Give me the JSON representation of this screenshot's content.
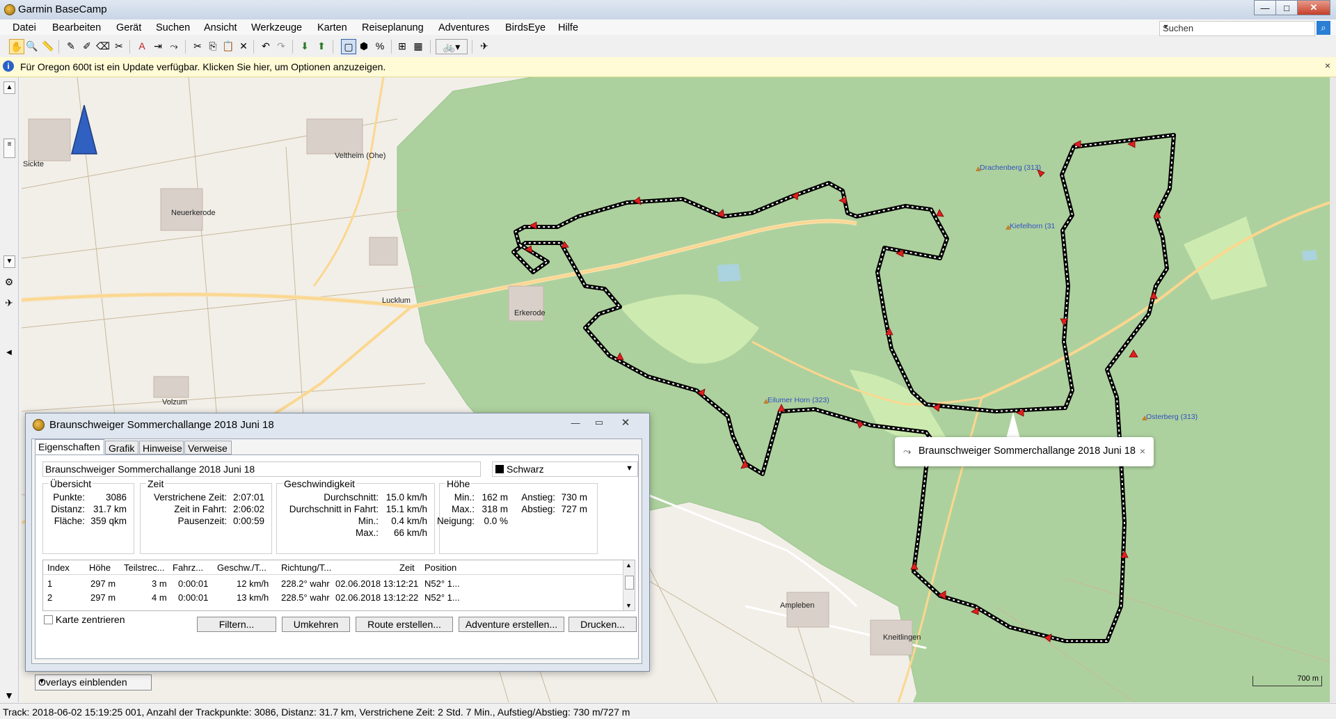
{
  "window": {
    "title": "Garmin BaseCamp",
    "min": "—",
    "max": "□",
    "close": "✕"
  },
  "menu": [
    "Datei",
    "Bearbeiten",
    "Gerät",
    "Suchen",
    "Ansicht",
    "Werkzeuge",
    "Karten",
    "Reiseplanung",
    "Adventures",
    "BirdsEye",
    "Hilfe"
  ],
  "search": {
    "placeholder": "Suchen"
  },
  "infobar": {
    "text": "Für Oregon 600t  ist ein Update verfügbar. Klicken Sie hier, um Optionen anzuzeigen."
  },
  "map": {
    "places": [
      {
        "name": "Sickte"
      },
      {
        "name": "Veltheim (Ohe)"
      },
      {
        "name": "Neuerkerode"
      },
      {
        "name": "Lucklum"
      },
      {
        "name": "Erkerode"
      },
      {
        "name": "Volzum"
      },
      {
        "name": "Ampleben"
      },
      {
        "name": "Kneitlingen"
      }
    ],
    "peaks": [
      {
        "name": "Drachenberg (313)"
      },
      {
        "name": "Kiefelhorn (31"
      },
      {
        "name": "Eilumer Horn (323)"
      },
      {
        "name": "Osterberg (313)"
      }
    ],
    "track_color": "#000000",
    "arrow_color": "#e02020",
    "forest_color": "#a9dba0",
    "scale": "700 m"
  },
  "popup": {
    "label": "Braunschweiger Sommerchallange 2018 Juni 18",
    "close": "×"
  },
  "overlays": {
    "label": "Overlays einblenden"
  },
  "status": "Track: 2018-06-02 15:19:25 001, Anzahl der Trackpunkte: 3086, Distanz: 31.7 km, Verstrichene Zeit: 2 Std. 7 Min., Aufstieg/Abstieg: 730 m/727 m",
  "dialog": {
    "title": "Braunschweiger Sommerchallange 2018 Juni 18",
    "tabs": [
      "Eigenschaften",
      "Grafik",
      "Hinweise",
      "Verweise"
    ],
    "name": "Braunschweiger Sommerchallange 2018 Juni 18",
    "color": "Schwarz",
    "overview": {
      "title": "Übersicht",
      "labels": [
        "Punkte:",
        "Distanz:",
        "Fläche:"
      ],
      "values": [
        "3086",
        "31.7 km",
        "359 qkm"
      ]
    },
    "time": {
      "title": "Zeit",
      "labels": [
        "Verstrichene Zeit:",
        "Zeit in Fahrt:",
        "Pausenzeit:"
      ],
      "values": [
        "2:07:01",
        "2:06:02",
        "0:00:59"
      ]
    },
    "speed": {
      "title": "Geschwindigkeit",
      "labels": [
        "Durchschnitt:",
        "Durchschnitt in Fahrt:",
        "Min.:",
        "Max.:"
      ],
      "values": [
        "15.0 km/h",
        "15.1 km/h",
        "0.4 km/h",
        "66 km/h"
      ]
    },
    "height": {
      "title": "Höhe",
      "labels": [
        "Min.:",
        "Max.:",
        "Neigung:"
      ],
      "values": [
        "162 m",
        "318 m",
        "0.0 %"
      ],
      "labels2": [
        "Anstieg:",
        "Abstieg:"
      ],
      "values2": [
        "730 m",
        "727 m"
      ]
    },
    "table": {
      "headers": [
        "Index",
        "Höhe",
        "Teilstrec...",
        "Fahrz...",
        "Geschw./T...",
        "Richtung/T...",
        "Zeit",
        "Position"
      ],
      "rows": [
        [
          "1",
          "297 m",
          "3 m",
          "0:00:01",
          "12 km/h",
          "228.2° wahr",
          "02.06.2018 13:12:21",
          "N52° 1..."
        ],
        [
          "2",
          "297 m",
          "4 m",
          "0:00:01",
          "13 km/h",
          "228.5° wahr",
          "02.06.2018 13:12:22",
          "N52° 1..."
        ]
      ]
    },
    "center_label": "Karte zentrieren",
    "buttons": [
      "Filtern...",
      "Umkehren",
      "Route erstellen...",
      "Adventure erstellen...",
      "Drucken..."
    ]
  }
}
